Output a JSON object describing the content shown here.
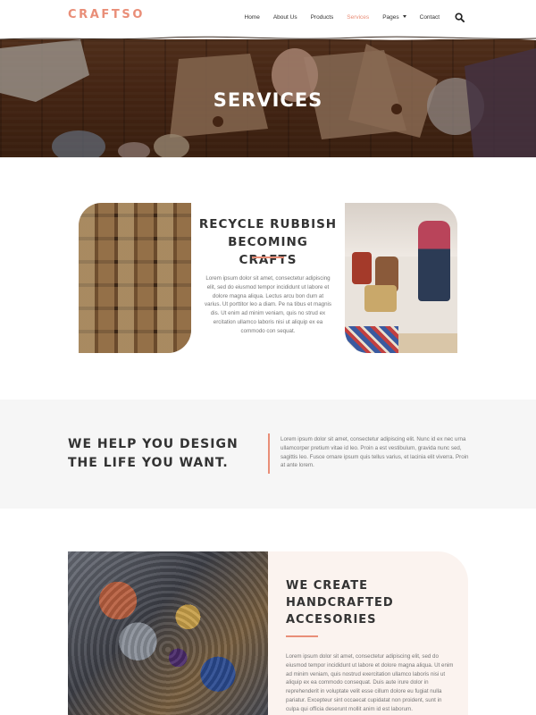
{
  "brand": {
    "logo": "CRAFTSO",
    "accent": "#e98e78"
  },
  "nav": {
    "items": [
      {
        "label": "Home"
      },
      {
        "label": "About Us"
      },
      {
        "label": "Products"
      },
      {
        "label": "Services",
        "active": true
      },
      {
        "label": "Pages",
        "dropdown": true
      },
      {
        "label": "Contact"
      }
    ],
    "search_icon": "search-icon"
  },
  "hero": {
    "title": "SERVICES"
  },
  "section1": {
    "title_line1": "RECYCLE RUBBISH",
    "title_line2": "BECOMING CRAFTS",
    "text": "Lorem ipsum dolor sit amet, consectetur adipiscing elit, sed do eiusmod tempor incididunt ut labore et dolore magna aliqua. Lectus arcu bon dum at varius. Ut porttitor leo a diam. Pe na tibus et magnis dis. Ut enim ad minim veniam, quis no strud ex ercitation ullamco laboris nisi ut aliquip ex ea commodo con sequat."
  },
  "section2": {
    "title_line1": "WE HELP YOU DESIGN",
    "title_line2": "THE LIFE YOU WANT.",
    "text": "Lorem ipsum dolor sit amet, consectetur adipiscing elit. Nunc id ex nec urna ullamcorper pretium vitae id leo. Proin a est vestibulum, gravida nunc sed, sagittis leo. Fusce ornare ipsum quis tellus varius, et lacinia elit viverra. Proin at ante lorem."
  },
  "section3": {
    "title_line1": "WE CREATE",
    "title_line2": "HANDCRAFTED",
    "title_line3": "ACCESORIES",
    "text": "Lorem ipsum dolor sit amet, consectetur adipiscing elit, sed do eiusmod tempor incididunt ut labore et dolore magna aliqua. Ut enim ad minim veniam, quis nostrud exercitation ullamco laboris nisi ut aliquip ex ea commodo consequat. Duis aute irure dolor in reprehenderit in voluptate velit esse cillum dolore eu fugiat nulla pariatur. Excepteur sint occaecat cupidatat non proident, sunt in culpa qui officia deserunt mollit anim id est laborum."
  }
}
